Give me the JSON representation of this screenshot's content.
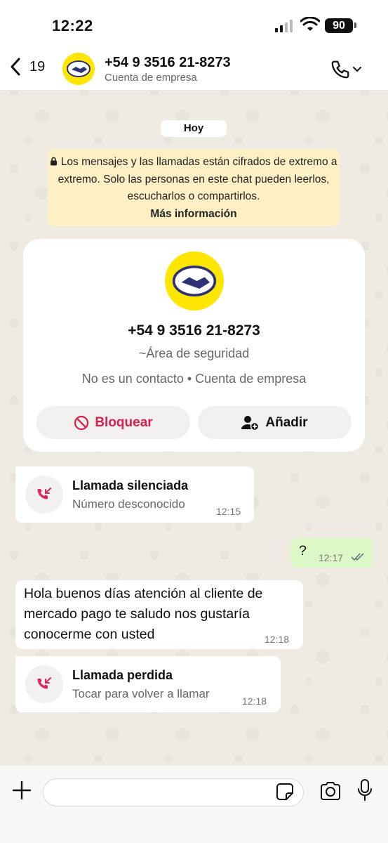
{
  "status_bar": {
    "time": "12:22",
    "battery": "90"
  },
  "header": {
    "back_count": "19",
    "contact_name": "+54 9 3516 21-8273",
    "contact_subtitle": "Cuenta de empresa"
  },
  "chat": {
    "date_label": "Hoy",
    "encryption_notice": "Los mensajes y las llamadas están cifrados de extremo a extremo. Solo las personas en este chat pueden leerlos, escucharlos o compartirlos.",
    "encryption_more": "Más información"
  },
  "business_card": {
    "phone": "+54 9 3516 21-8273",
    "label": "~Área de seguridad",
    "meta": "No es un contacto • Cuenta de empresa",
    "block_label": "Bloquear",
    "add_label": "Añadir"
  },
  "messages": [
    {
      "type": "call",
      "title": "Llamada silenciada",
      "subtitle": "Número desconocido",
      "time": "12:15"
    },
    {
      "type": "outgoing",
      "text": "?",
      "time": "12:17"
    },
    {
      "type": "incoming",
      "lines": [
        "Hola buenos días atención al cliente de",
        "mercado pago te saludo nos gustaría",
        "conocerme con usted"
      ],
      "time": "12:18"
    },
    {
      "type": "call",
      "title": "Llamada perdida",
      "subtitle": "Tocar para volver a llamar",
      "time": "12:18"
    }
  ],
  "colors": {
    "brand_yellow": "#ffe600",
    "block_red": "#d6204f",
    "missed_call_red": "#e0245e",
    "outgoing_bubble": "#dcf8c6",
    "encryption_bg": "#fdf0c4",
    "read_ticks": "#5a6b7a"
  },
  "icons": [
    "back-chevron-icon",
    "handshake-logo-icon",
    "phone-icon",
    "chevron-down-icon",
    "lock-icon",
    "block-icon",
    "add-contact-icon",
    "missed-call-icon",
    "double-check-icon",
    "plus-icon",
    "sticker-icon",
    "camera-icon",
    "microphone-icon",
    "signal-icon",
    "wifi-icon"
  ]
}
